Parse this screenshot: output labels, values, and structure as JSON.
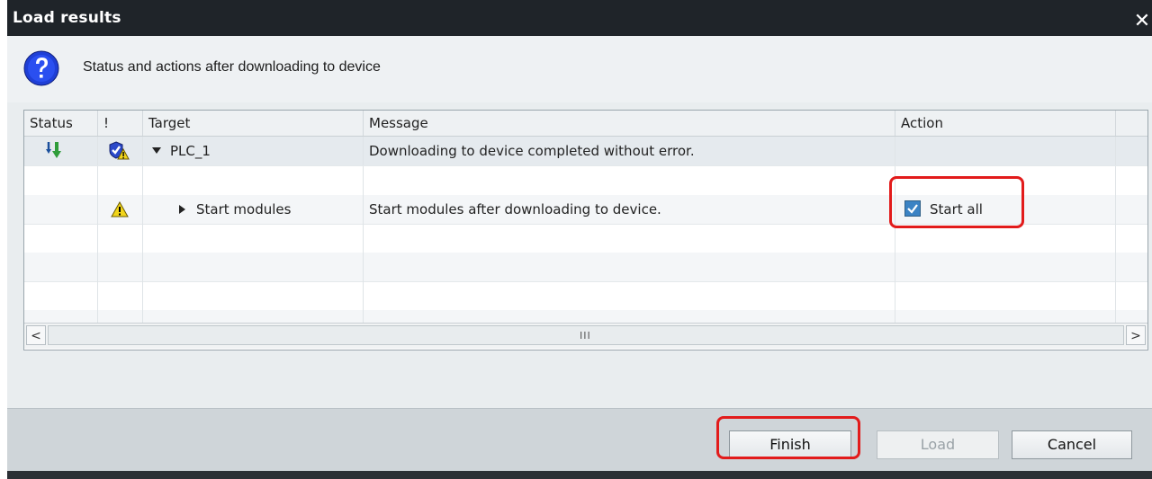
{
  "window": {
    "title": "Load results",
    "close_glyph": "✕"
  },
  "header": {
    "icon": "question-icon",
    "subtitle": "Status and actions after downloading to device"
  },
  "table": {
    "columns": [
      "Status",
      "!",
      "Target",
      "Message",
      "Action"
    ],
    "rows": [
      {
        "status_icon": "download-arrow-icon",
        "flag_icon": "check-warning-icon",
        "target": "PLC_1",
        "expanded": true,
        "message": "Downloading to device completed without error.",
        "action": ""
      },
      {
        "status_icon": "",
        "flag_icon": "",
        "target": "",
        "message": "",
        "action": ""
      },
      {
        "status_icon": "",
        "flag_icon": "warning-icon",
        "target": "Start modules",
        "expanded": false,
        "message": "Start modules after downloading to device.",
        "action": "Start all",
        "checked": true
      }
    ]
  },
  "scrollbar": {
    "left": "<",
    "right": ">",
    "grip": "III"
  },
  "buttons": {
    "finish": "Finish",
    "load": "Load",
    "cancel": "Cancel"
  },
  "colors": {
    "highlight": "#e21b1b",
    "titlebar": "#1f2429",
    "accent": "#3b83c4"
  }
}
